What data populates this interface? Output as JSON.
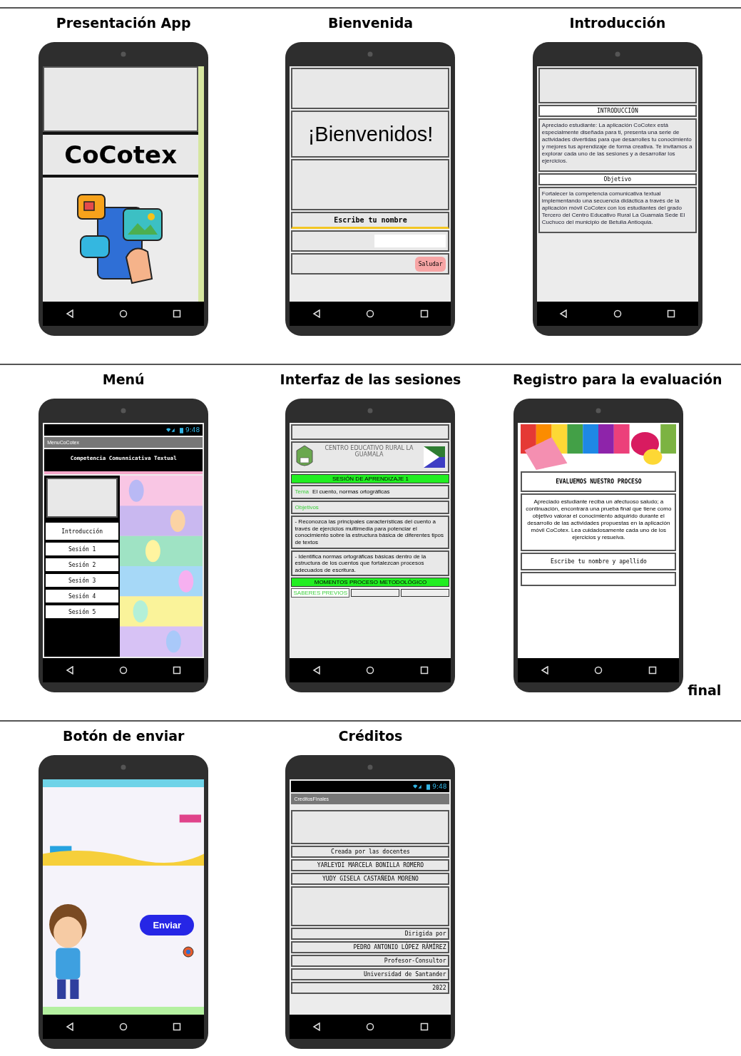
{
  "rows": [
    {
      "panels": [
        {
          "kind": "presentacion",
          "title": "Presentación App",
          "logo_text": "CoCotex"
        },
        {
          "kind": "bienvenida",
          "title": "Bienvenida",
          "heading": "¡Bienvenidos!",
          "prompt": "Escribe tu nombre",
          "button": "Saludar"
        },
        {
          "kind": "introduccion",
          "title": "Introducción",
          "sections": [
            {
              "heading": "INTRODUCCIÓN",
              "body": "Apreciado estudiante: La aplicación CoCotex está especialmente diseñada para ti, presenta una serie de actividades divertidas para que desarrolles tu conocimiento y mejores tus aprendizaje de forma creativa. Te invitamos a explorar cada uno de las sesiones y a desarrollar los ejercicios."
            },
            {
              "heading": "Objetivo",
              "body": "Fortalecer la competencia comunicativa textual implementando una secuencia didáctica a través de la aplicación móvil CoCotex con los estudiantes del grado Tercero del Centro Educativo Rural La Guamala Sede El Cuchuco del municipio de Betulia Antioquia."
            }
          ]
        }
      ]
    },
    {
      "panels": [
        {
          "kind": "menu",
          "title": "Menú",
          "time": "9:48",
          "app_title": "MenuCoCotex",
          "banner": "Competencia Comunnicativa Textual",
          "items": [
            "Introducción",
            "Sesión 1",
            "Sesión 2",
            "Sesión 3",
            "Sesión 4",
            "Sesión 5"
          ]
        },
        {
          "kind": "sesiones",
          "title": "Interfaz de las sesiones",
          "school": "CENTRO EDUCATIVO RURAL LA GUAMALA",
          "session": "SESIÓN DE APRENDIZAJE 1",
          "topic_label": "Tema",
          "topic": "El cuento, normas ortográficas",
          "objectives_label": "Objetivos",
          "objectives": [
            "- Reconozca las principales características del cuento a través de ejercicios multimedia para potenciar el conocimiento sobre la estructura básica de diferentes tipos de textos",
            "- Identifica normas ortográficas básicas dentro de la estructura de los cuentos que fortalezcan procesos adecuados de escritura."
          ],
          "moments": "MOMENTOS PROCESO METODOLÓGICO",
          "prior": "SABERES PREVIOS"
        },
        {
          "kind": "registro",
          "title": "Registro para la evaluación",
          "heading": "EVALUEMOS NUESTRO PROCESO",
          "body": "Apreciado estudiante reciba un afectuoso saludo; a continuación, encontrará una prueba final que tiene como objetivo valorar el conocimiento adquirido durante el desarrollo de las actividades propuestas en la aplicación móvil CoCotex. Lea cuidadosamente cada uno de los ejercicios y resuelva.",
          "prompt": "Escribe tu nombre y apellido",
          "note": "final"
        }
      ]
    },
    {
      "panels": [
        {
          "kind": "enviar",
          "title": "Botón de enviar",
          "button": "Enviar"
        },
        {
          "kind": "creditos",
          "title": "Créditos",
          "time": "9:48",
          "app_title": "CreditosFinales",
          "lines": [
            "Creada por las docentes",
            "YARLEYDI MARCELA BONILLA ROMERO",
            "YUDY GISELA CASTAÑEDA MORENO",
            "Dirigida por",
            "PEDRO ANTONIO LÓPEZ RÁMÍREZ",
            "Profesor-Consultor",
            "Universidad de Santander",
            "2022"
          ]
        }
      ]
    }
  ]
}
